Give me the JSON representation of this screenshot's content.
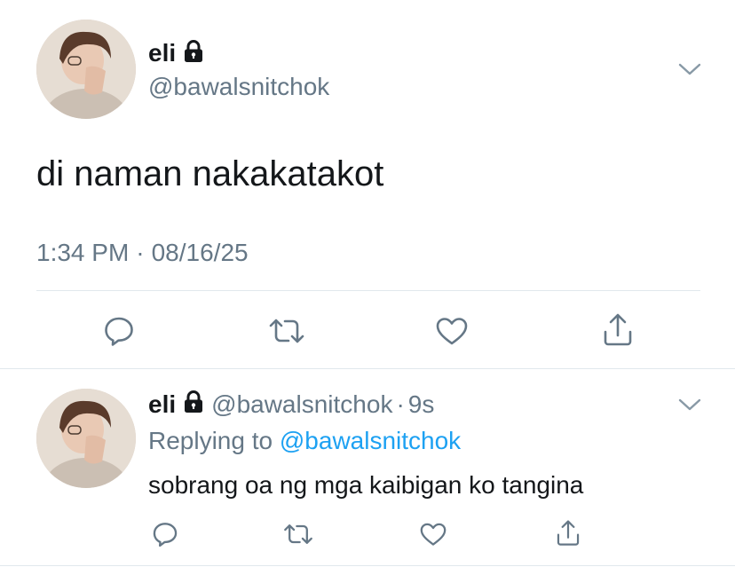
{
  "tweet": {
    "display_name": "eli",
    "handle": "@bawalsnitchok",
    "text": "di naman nakakatakot",
    "time": "1:34 PM",
    "date": "08/16/25",
    "separator": "·",
    "lock_icon": "lock-icon",
    "menu_icon": "chevron-down-icon",
    "actions": [
      "reply-icon",
      "retweet-icon",
      "like-icon",
      "share-icon"
    ]
  },
  "reply": {
    "display_name": "eli",
    "handle": "@bawalsnitchok",
    "separator": "·",
    "age": "9s",
    "replying_prefix": "Replying to",
    "replying_handle": "@bawalsnitchok",
    "text": "sobrang oa ng mga kaibigan ko tangina",
    "lock_icon": "lock-icon",
    "menu_icon": "chevron-down-icon",
    "actions": [
      "reply-icon",
      "retweet-icon",
      "like-icon",
      "share-icon"
    ]
  },
  "colors": {
    "text_primary": "#14171a",
    "text_secondary": "#657786",
    "link": "#1da1f2",
    "divider": "#e1e8ed",
    "icon": "#657786"
  }
}
